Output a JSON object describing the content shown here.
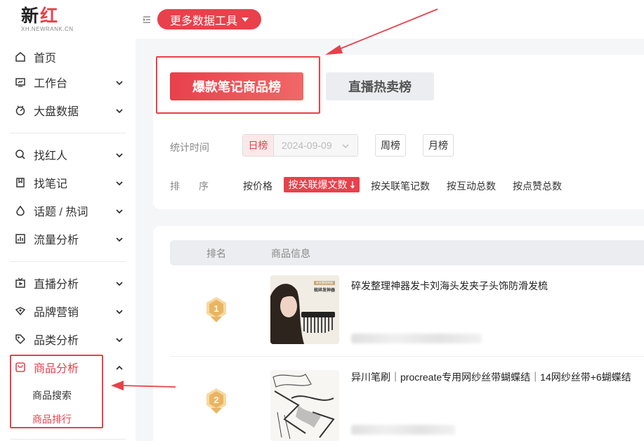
{
  "logo": {
    "brand_left": "新",
    "brand_right": "红",
    "sub": "XH.NEWRANK.CN"
  },
  "sidebar": {
    "items": [
      {
        "label": "首页",
        "icon": "home-icon"
      },
      {
        "label": "工作台",
        "icon": "workbench-icon"
      },
      {
        "label": "大盘数据",
        "icon": "market-data-icon"
      },
      {
        "label": "找红人",
        "icon": "search-user-icon"
      },
      {
        "label": "找笔记",
        "icon": "note-icon"
      },
      {
        "label": "话题 / 热词",
        "icon": "topic-icon"
      },
      {
        "label": "流量分析",
        "icon": "traffic-chart-icon"
      },
      {
        "label": "直播分析",
        "icon": "live-tv-icon"
      },
      {
        "label": "品牌营销",
        "icon": "brand-icon"
      },
      {
        "label": "品类分析",
        "icon": "tag-icon"
      },
      {
        "label": "商品分析",
        "icon": "shopping-bag-icon"
      }
    ],
    "sub_items": [
      "商品搜索",
      "商品排行"
    ]
  },
  "topbar": {
    "tools_label": "更多数据工具"
  },
  "tabs": {
    "active": "爆款笔记商品榜",
    "inactive": "直播热卖榜"
  },
  "filters": {
    "time_label": "统计时间",
    "day_label": "日榜",
    "date_value": "2024-09-09",
    "week_label": "周榜",
    "month_label": "月榜",
    "sort_label_1": "排",
    "sort_label_2": "序",
    "sort_options": [
      "按价格",
      "按关联爆文数",
      "按关联笔记数",
      "按互动总数",
      "按点赞总数"
    ]
  },
  "table": {
    "headers": [
      "排名",
      "商品信息"
    ],
    "rows": [
      {
        "rank": "1",
        "name": "碎发整理神器发卡刘海头发夹子头饰防滑发梳",
        "thumb_caption_1": "碎发整理神器",
        "thumb_caption_2": "梳碎发神器"
      },
      {
        "rank": "2",
        "name": "异川笔刷｜procreate专用网纱丝带蝴蝶结｜14网纱丝带+6蝴蝶结"
      }
    ]
  },
  "colors": {
    "accent": "#e8414b",
    "medal": "#e8b04a"
  }
}
